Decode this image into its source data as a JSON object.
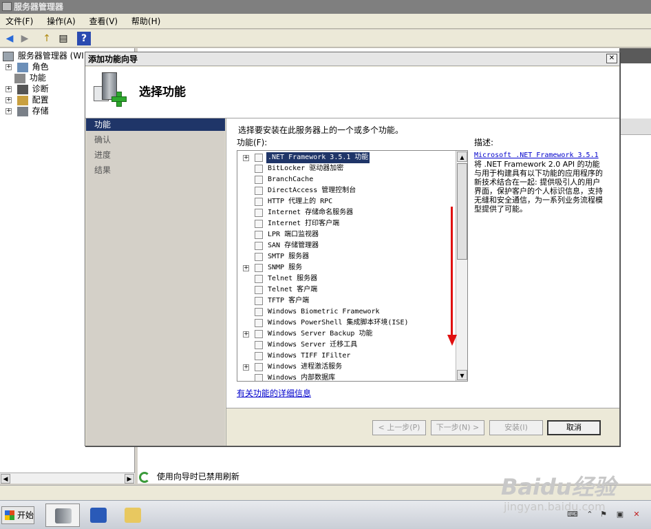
{
  "window": {
    "title": "服务器管理器"
  },
  "menubar": [
    "文件(F)",
    "操作(A)",
    "查看(V)",
    "帮助(H)"
  ],
  "toolbar": {
    "back": "◀",
    "forward": "▶",
    "up": "↑",
    "view": "▤",
    "help": "?"
  },
  "tree": {
    "root": "服务器管理器 (WI",
    "items": [
      {
        "label": "角色",
        "icon": "roles-icon"
      },
      {
        "label": "功能",
        "icon": "features-icon"
      },
      {
        "label": "诊断",
        "icon": "diagnostics-icon"
      },
      {
        "label": "配置",
        "icon": "configuration-icon"
      },
      {
        "label": "存储",
        "icon": "storage-icon"
      }
    ]
  },
  "status": {
    "refresh_text": "使用向导时已禁用刷新"
  },
  "taskbar": {
    "start_label": "开始"
  },
  "wizard": {
    "title": "添加功能向导",
    "heading": "选择功能",
    "steps": [
      "功能",
      "确认",
      "进度",
      "结果"
    ],
    "instructions": "选择要安装在此服务器上的一个或多个功能。",
    "features_label": "功能(F):",
    "description_label": "描述:",
    "description_link": "Microsoft .NET Framework 3.5.1",
    "description_text": "将 .NET Framework 2.0 API 的功能与用于构建具有以下功能的应用程序的新技术结合在一起: 提供吸引人的用户界面，保护客户的个人标识信息，支持无缝和安全通信，为一系列业务流程模型提供了可能。",
    "more_info_link": "有关功能的详细信息",
    "features": [
      {
        "label": ".NET Framework 3.5.1 功能",
        "expandable": true,
        "selected": true
      },
      {
        "label": "BitLocker 驱动器加密",
        "expandable": false
      },
      {
        "label": "BranchCache",
        "expandable": false
      },
      {
        "label": "DirectAccess 管理控制台",
        "expandable": false
      },
      {
        "label": "HTTP 代理上的 RPC",
        "expandable": false
      },
      {
        "label": "Internet 存储命名服务器",
        "expandable": false
      },
      {
        "label": "Internet 打印客户端",
        "expandable": false
      },
      {
        "label": "LPR 端口监视器",
        "expandable": false
      },
      {
        "label": "SAN 存储管理器",
        "expandable": false
      },
      {
        "label": "SMTP 服务器",
        "expandable": false
      },
      {
        "label": "SNMP 服务",
        "expandable": true
      },
      {
        "label": "Telnet 服务器",
        "expandable": false
      },
      {
        "label": "Telnet 客户端",
        "expandable": false
      },
      {
        "label": "TFTP 客户端",
        "expandable": false
      },
      {
        "label": "Windows Biometric Framework",
        "expandable": false
      },
      {
        "label": "Windows PowerShell 集成脚本环境(ISE)",
        "expandable": false
      },
      {
        "label": "Windows Server Backup 功能",
        "expandable": true
      },
      {
        "label": "Windows Server 迁移工具",
        "expandable": false
      },
      {
        "label": "Windows TIFF IFilter",
        "expandable": false
      },
      {
        "label": "Windows 进程激活服务",
        "expandable": true
      },
      {
        "label": "Windows 内部数据库",
        "expandable": false
      }
    ],
    "buttons": {
      "prev": "< 上一步(P)",
      "next": "下一步(N) >",
      "install": "安装(I)",
      "cancel": "取消"
    }
  },
  "watermark": {
    "brand": "Baidu经验",
    "url": "jingyan.baidu.com"
  },
  "colors": {
    "selection": "#1f3568",
    "link": "#0000cc",
    "arrow": "#e01010"
  }
}
